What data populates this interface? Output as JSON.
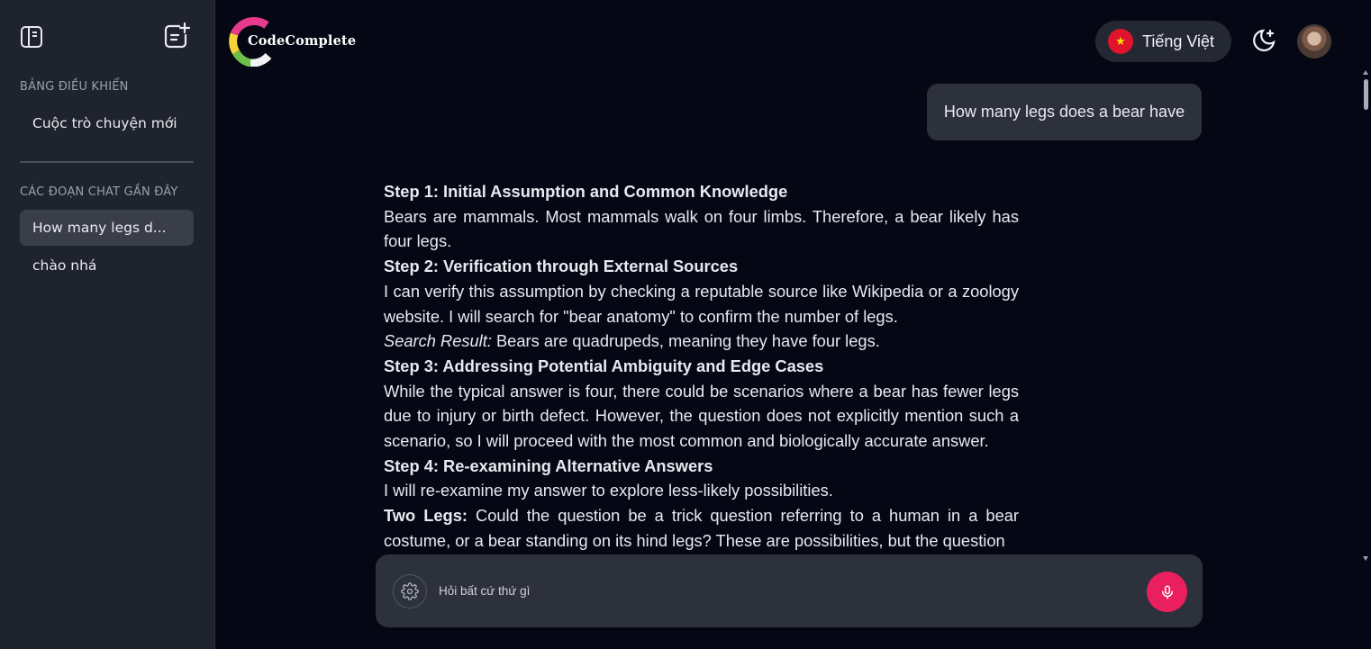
{
  "sidebar": {
    "dashboard_title": "BẢNG ĐIỀU KHIỂN",
    "new_chat_label": "Cuộc trò chuyện mới",
    "recent_title": "CÁC ĐOẠN CHAT GẦN ĐÂY",
    "recent_chats": [
      {
        "label": "How many legs d...",
        "active": true
      },
      {
        "label": "chào nhá",
        "active": false
      }
    ],
    "toggle_icon": "sidebar-toggle-icon",
    "new_icon": "new-chat-icon"
  },
  "header": {
    "logo_text": "CodeComplete",
    "language_label": "Tiếng Việt",
    "flag_icon": "vietnam-flag-icon",
    "theme_icon": "moon-sparkle-icon",
    "avatar_icon": "user-avatar"
  },
  "conversation": {
    "user_message": "How many legs does a bear have",
    "answer": [
      {
        "heading": "Step 1: Initial Assumption and Common Knowledge"
      },
      {
        "text": "Bears are mammals. Most mammals walk on four limbs. Therefore, a bear likely has four legs."
      },
      {
        "heading": "Step 2: Verification through External Sources"
      },
      {
        "text": "I can verify this assumption by checking a reputable source like Wikipedia or a zoology website. I will search for \"bear anatomy\" to confirm the number of legs."
      },
      {
        "italic_label": "Search Result:",
        "text": " Bears are quadrupeds, meaning they have four legs."
      },
      {
        "heading": "Step 3: Addressing Potential Ambiguity and Edge Cases"
      },
      {
        "text": "While the typical answer is four, there could be scenarios where a bear has fewer legs due to injury or birth defect. However, the question does not explicitly mention such a scenario, so I will proceed with the most common and biologically accurate answer."
      },
      {
        "heading": "Step 4: Re-examining Alternative Answers"
      },
      {
        "text": "I will re-examine my answer to explore less-likely possibilities."
      },
      {
        "bold_label": "Two Legs:",
        "text": " Could the question be a trick question referring to a human in a bear costume, or a bear standing on its hind legs? These are possibilities, but the question"
      }
    ]
  },
  "input": {
    "placeholder": "Hỏi bất cứ thứ gì",
    "settings_icon": "gear-icon",
    "mic_icon": "microphone-icon"
  },
  "colors": {
    "background": "#050814",
    "sidebar": "#1e232d",
    "bubble": "#2d313b",
    "accent": "#ea1f5f",
    "flag_red": "#e0142c"
  }
}
